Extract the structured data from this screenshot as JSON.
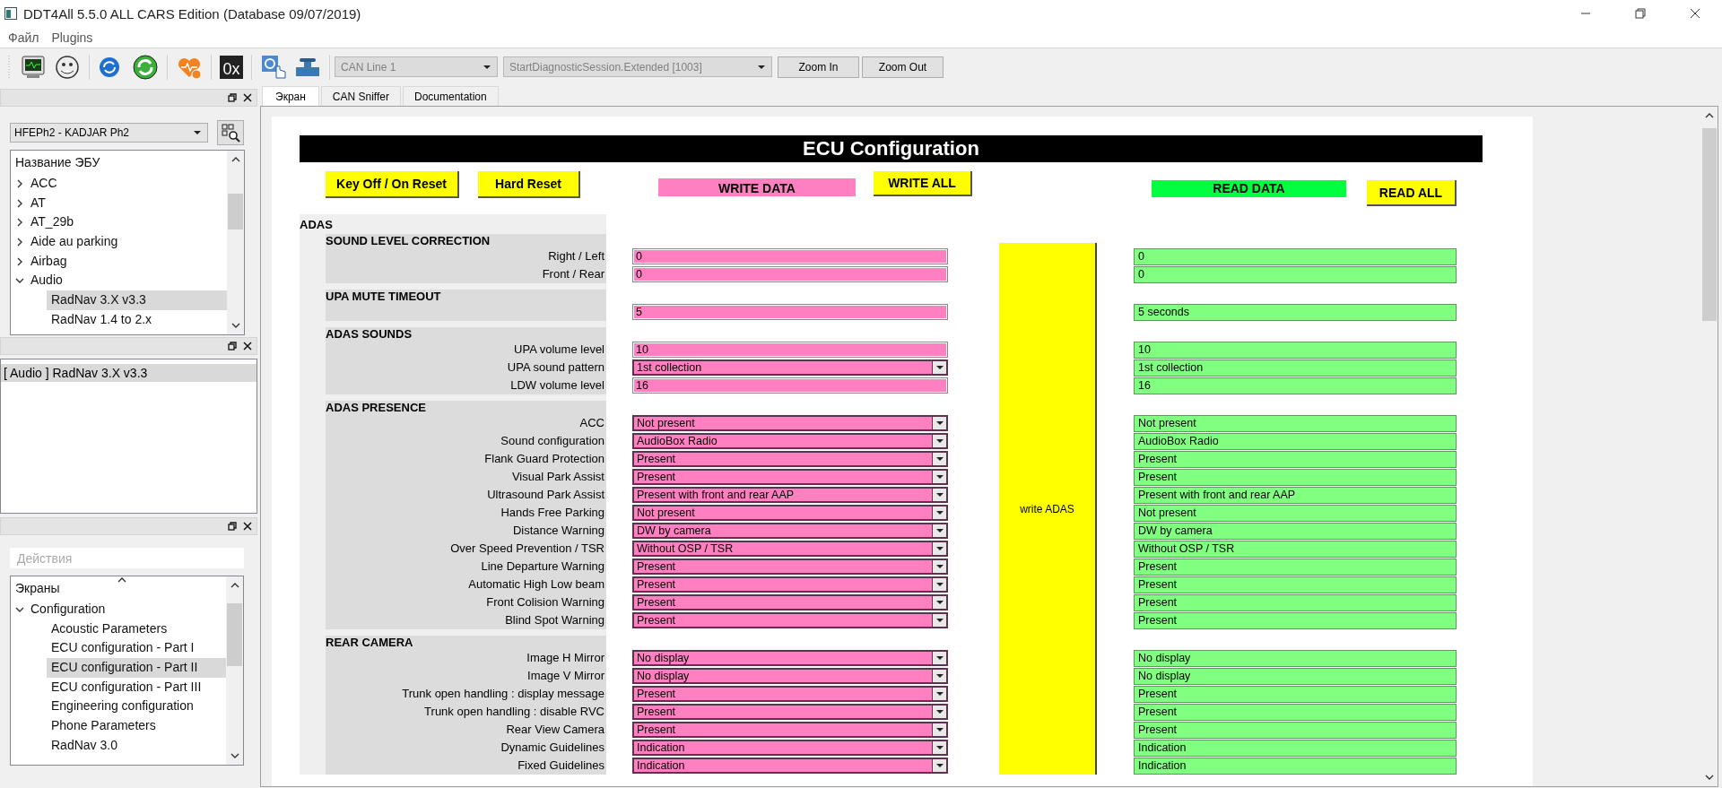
{
  "window": {
    "title": "DDT4All 5.5.0 ALL CARS Edition (Database 09/07/2019)"
  },
  "menu": [
    "Файл",
    "Plugins"
  ],
  "toolbar": {
    "hex_label": "0x",
    "bus_combo": {
      "value": "CAN Line 1",
      "disabled": true
    },
    "session_combo": {
      "value": "StartDiagnosticSession.Extended [1003]",
      "disabled": true
    },
    "buttons": [
      "Zoom In",
      "Zoom Out"
    ]
  },
  "ecu_selector": {
    "value": "HFEPh2 - KADJAR Ph2"
  },
  "ecu_tree": {
    "header": "Название ЭБУ",
    "items": [
      {
        "label": "ACC",
        "expanded": false,
        "selected": false
      },
      {
        "label": "AT",
        "expanded": false,
        "selected": false
      },
      {
        "label": "AT_29b",
        "expanded": false,
        "selected": false
      },
      {
        "label": "Aide au parking",
        "expanded": false,
        "selected": false
      },
      {
        "label": "Airbag",
        "expanded": false,
        "selected": false
      },
      {
        "label": "Audio",
        "expanded": true,
        "selected": false,
        "children": [
          {
            "label": "RadNav 3.X v3.3",
            "selected": true
          },
          {
            "label": "RadNav 1.4 to 2.x",
            "selected": false
          }
        ]
      }
    ]
  },
  "selected_ecus": [
    {
      "label": "[ Audio ] RadNav 3.X v3.3",
      "selected": true
    }
  ],
  "screen_filter": {
    "placeholder": "Действия"
  },
  "screen_tree": {
    "header": "Экраны",
    "items": [
      {
        "label": "Configuration",
        "expanded": true,
        "selected": false,
        "children": [
          {
            "label": "Acoustic Parameters",
            "selected": false
          },
          {
            "label": "ECU configuration - Part I",
            "selected": false
          },
          {
            "label": "ECU configuration - Part II",
            "selected": true
          },
          {
            "label": "ECU configuration - Part III",
            "selected": false
          },
          {
            "label": "Engineering configuration",
            "selected": false
          },
          {
            "label": "Phone Parameters",
            "selected": false
          },
          {
            "label": "RadNav 3.0",
            "selected": false
          }
        ]
      }
    ]
  },
  "tabs": [
    {
      "label": "Экран",
      "selected": true
    },
    {
      "label": "CAN Sniffer",
      "selected": false
    },
    {
      "label": "Documentation",
      "selected": false
    }
  ],
  "form": {
    "title": "ECU Configuration",
    "key_reset_button": "Key Off / On Reset",
    "hard_reset_button": "Hard Reset",
    "write_data_label": "WRITE DATA",
    "write_all_button": "WRITE ALL",
    "read_data_label": "READ DATA",
    "read_all_button": "READ ALL",
    "group": "ADAS",
    "write_group_button": "write ADAS",
    "sections": [
      {
        "title": "SOUND LEVEL CORRECTION",
        "items": [
          {
            "label": "Right / Left",
            "kind": "text",
            "write_value": "0",
            "read_value": "0"
          },
          {
            "label": "Front / Rear",
            "kind": "text",
            "write_value": "0",
            "read_value": "0"
          }
        ]
      },
      {
        "title": "UPA MUTE TIMEOUT",
        "items": [
          {
            "kind": "text",
            "write_value": "5",
            "read_value": "5 seconds"
          }
        ]
      },
      {
        "title": "ADAS SOUNDS",
        "items": [
          {
            "label": "UPA volume level",
            "kind": "text",
            "write_value": "10",
            "read_value": "10"
          },
          {
            "label": "UPA sound pattern",
            "kind": "combo",
            "write_value": "1st collection",
            "read_value": "1st collection"
          },
          {
            "label": "LDW volume level",
            "kind": "text",
            "write_value": "16",
            "read_value": "16"
          }
        ]
      },
      {
        "title": "ADAS PRESENCE",
        "items": [
          {
            "label": "ACC",
            "kind": "combo",
            "write_value": "Not present",
            "read_value": "Not present"
          },
          {
            "label": "Sound configuration",
            "kind": "combo",
            "write_value": "AudioBox Radio",
            "read_value": "AudioBox Radio"
          },
          {
            "label": "Flank Guard Protection",
            "kind": "combo",
            "write_value": "Present",
            "read_value": "Present"
          },
          {
            "label": "Visual Park Assist",
            "kind": "combo",
            "write_value": "Present",
            "read_value": "Present"
          },
          {
            "label": "Ultrasound Park Assist",
            "kind": "combo",
            "write_value": "Present with front and rear AAP",
            "read_value": "Present with front and rear AAP"
          },
          {
            "label": "Hands Free Parking",
            "kind": "combo",
            "write_value": "Not present",
            "read_value": "Not present"
          },
          {
            "label": "Distance Warning",
            "kind": "combo",
            "write_value": "DW by camera",
            "read_value": "DW by camera"
          },
          {
            "label": "Over Speed Prevention / TSR",
            "kind": "combo",
            "write_value": "Without OSP / TSR",
            "read_value": "Without OSP / TSR"
          },
          {
            "label": "Line Departure Warning",
            "kind": "combo",
            "write_value": "Present",
            "read_value": "Present"
          },
          {
            "label": "Automatic High Low beam",
            "kind": "combo",
            "write_value": "Present",
            "read_value": "Present"
          },
          {
            "label": "Front Colision Warning",
            "kind": "combo",
            "write_value": "Present",
            "read_value": "Present"
          },
          {
            "label": "Blind Spot Warning",
            "kind": "combo",
            "write_value": "Present",
            "read_value": "Present"
          }
        ]
      },
      {
        "title": "REAR CAMERA",
        "items": [
          {
            "label": "Image H Mirror",
            "kind": "combo",
            "write_value": "No display",
            "read_value": "No display"
          },
          {
            "label": "Image V Mirror",
            "kind": "combo",
            "write_value": "No display",
            "read_value": "No display"
          },
          {
            "label": "Trunk open handling : display message",
            "kind": "combo",
            "write_value": "Present",
            "read_value": "Present"
          },
          {
            "label": "Trunk open handling : disable RVC",
            "kind": "combo",
            "write_value": "Present",
            "read_value": "Present"
          },
          {
            "label": "Rear View Camera",
            "kind": "combo",
            "write_value": "Present",
            "read_value": "Present"
          },
          {
            "label": "Dynamic Guidelines",
            "kind": "combo",
            "write_value": "Indication",
            "read_value": "Indication"
          },
          {
            "label": "Fixed Guidelines",
            "kind": "combo",
            "write_value": "Indication",
            "read_value": "Indication"
          }
        ]
      }
    ]
  }
}
